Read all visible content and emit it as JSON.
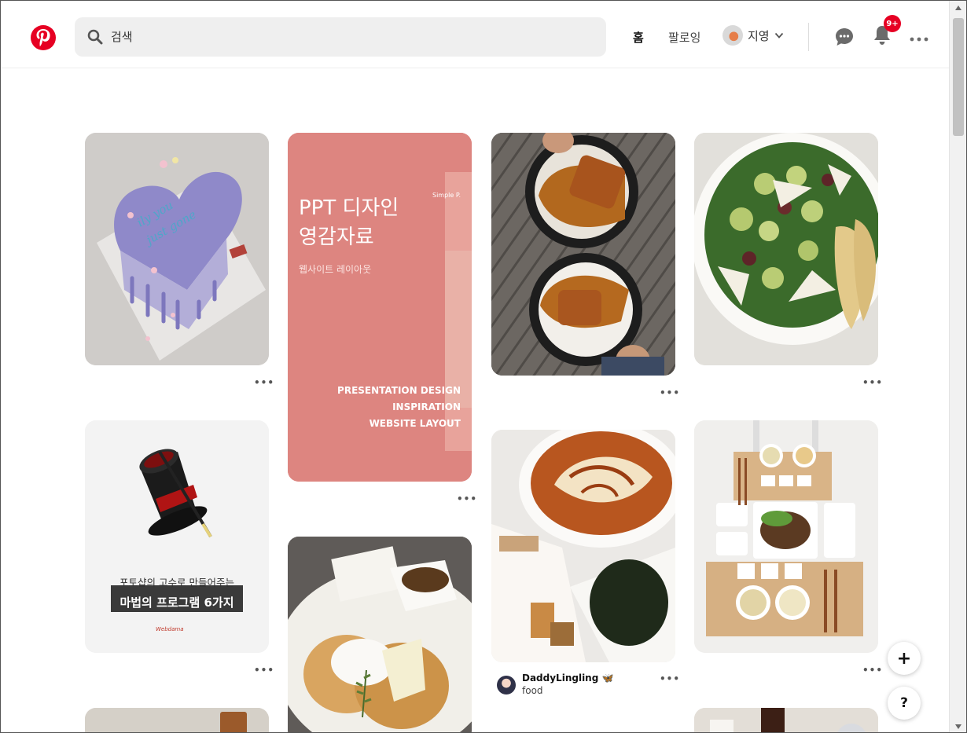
{
  "header": {
    "search_placeholder": "검색",
    "nav_home": "홈",
    "nav_following": "팔로잉",
    "profile_name": "지영",
    "notification_badge": "9+"
  },
  "pins": {
    "ppt": {
      "title_line1": "PPT 디자인",
      "title_line2": "영감자료",
      "subtitle": "웹사이트 레이아웃",
      "brand": "Simple P.",
      "en_line1": "PRESENTATION DESIGN",
      "en_line2": "INSPIRATION",
      "en_line3": "WEBSITE LAYOUT"
    },
    "magic": {
      "line1": "포토샵의 고수로 만들어주는",
      "line2": "마법의 프로그램 6가지"
    },
    "tteokbokki": {
      "author": "DaddyLingling",
      "author_emoji": "🦋",
      "board": "food"
    },
    "more_label": "•••"
  },
  "fab": {
    "add_label": "+",
    "help_label": "?"
  },
  "colors": {
    "brand": "#e60023",
    "ppt_bg": "#dd8580"
  }
}
